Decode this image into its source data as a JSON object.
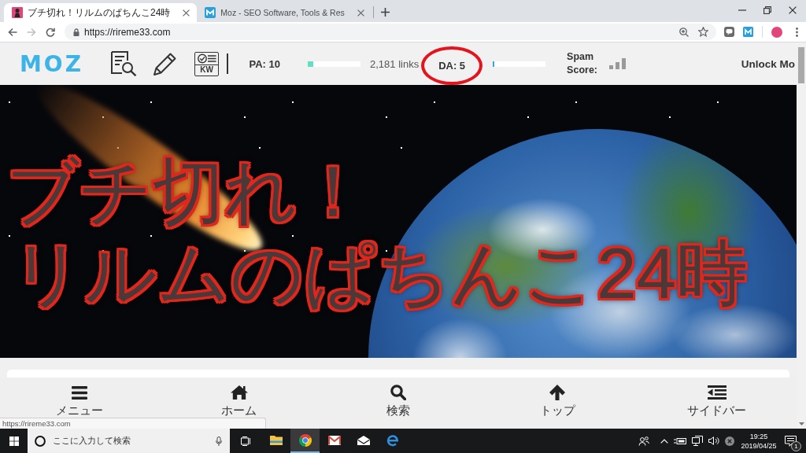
{
  "browser": {
    "tabs": [
      {
        "title": "ブチ切れ！リルムのぱちんこ24時",
        "selected": true
      },
      {
        "title": "Moz - SEO Software, Tools & Res",
        "selected": false
      }
    ],
    "address_bar": {
      "url": "https://rireme33.com"
    }
  },
  "moz_bar": {
    "logo": "MOZ",
    "keyword_tool": "KW",
    "metrics": [
      {
        "label": "PA: 10",
        "level": 0.1,
        "color": "#5fe0c2",
        "detail": "2,181 links",
        "circled": false
      },
      {
        "label": "DA: 5",
        "level": 0.03,
        "color": "#3aa6e0",
        "circled": true
      }
    ],
    "spam_score": "Spam Score:",
    "unlock": "Unlock Mo"
  },
  "banner": {
    "title_lines": [
      "ブチ切れ！",
      "リルムのぱちんこ24時"
    ]
  },
  "bottom_nav": [
    {
      "label": "メニュー"
    },
    {
      "label": "ホーム"
    },
    {
      "label": "検索"
    },
    {
      "label": "トップ"
    },
    {
      "label": "サイドバー"
    }
  ],
  "status_bubble": {
    "url": "https://rireme33.com"
  },
  "taskbar": {
    "search": {
      "placeholder": "ここに入力して検索"
    },
    "apps": [
      {
        "selected": false
      },
      {
        "selected": true
      },
      {
        "selected": false
      },
      {
        "selected": false
      },
      {
        "selected": false
      }
    ],
    "clock": {
      "time": "19:25",
      "date": "2019/04/25"
    },
    "notifications": "1"
  }
}
